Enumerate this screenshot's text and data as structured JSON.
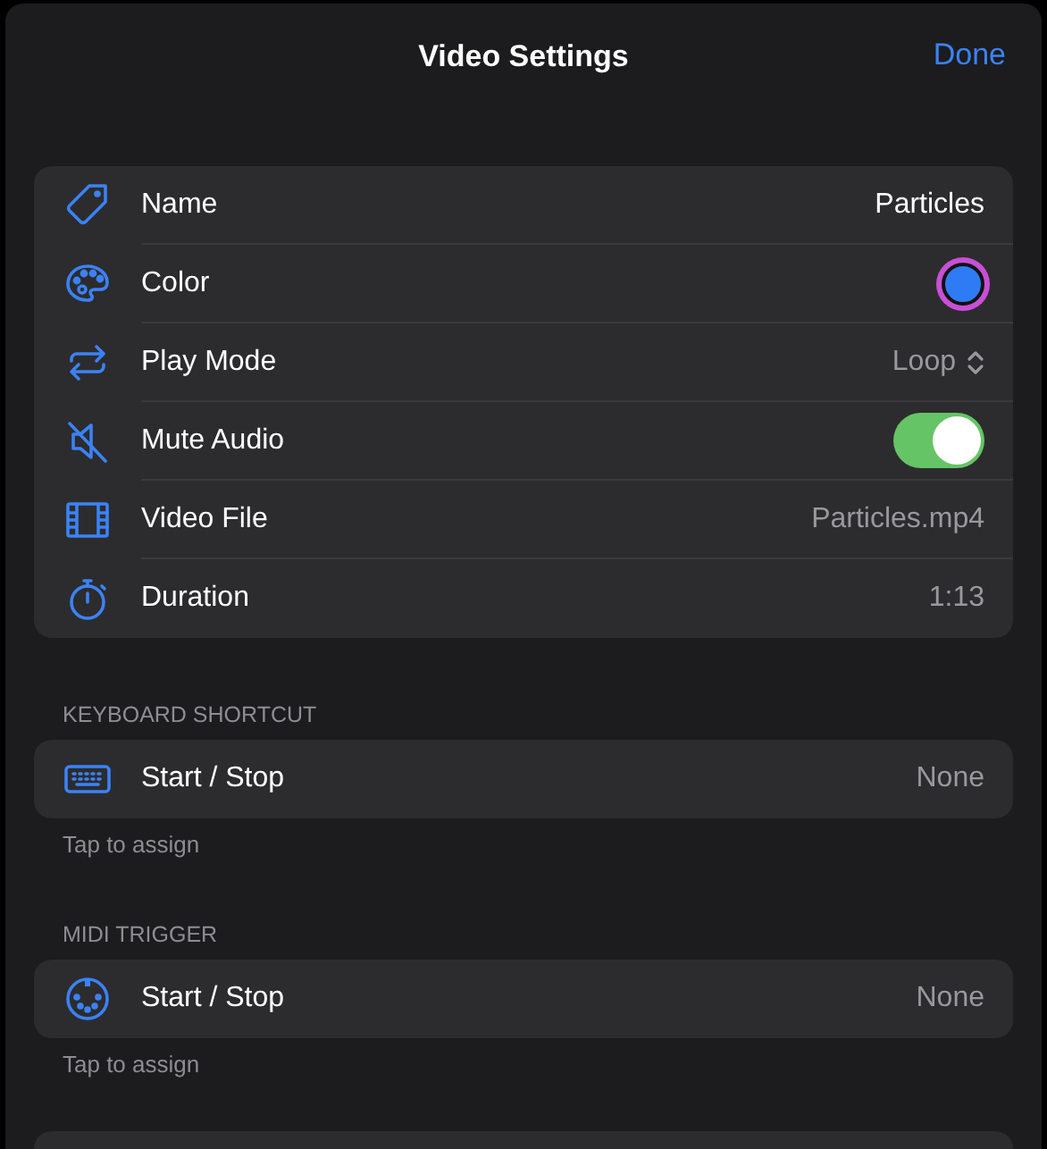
{
  "sheet": {
    "title": "Video Settings",
    "done_button": "Done"
  },
  "settings": [
    {
      "kind": "field",
      "label": "Name",
      "value": "Particles"
    },
    {
      "kind": "color",
      "label": "Color",
      "color": "#2f7bf5"
    },
    {
      "kind": "menu",
      "label": "Play Mode",
      "value": "Loop"
    },
    {
      "kind": "toggle",
      "label": "Mute Audio",
      "on": true
    },
    {
      "kind": "value",
      "label": "Video File",
      "value": "Particles.mp4"
    },
    {
      "kind": "value",
      "label": "Duration",
      "value": "1:13"
    }
  ],
  "sections": [
    {
      "header": "KEYBOARD SHORTCUT",
      "label": "Start / Stop",
      "value": "None",
      "footer": "Tap to assign"
    },
    {
      "header": "MIDI TRIGGER",
      "label": "Start / Stop",
      "value": "None",
      "footer": "Tap to assign"
    }
  ]
}
